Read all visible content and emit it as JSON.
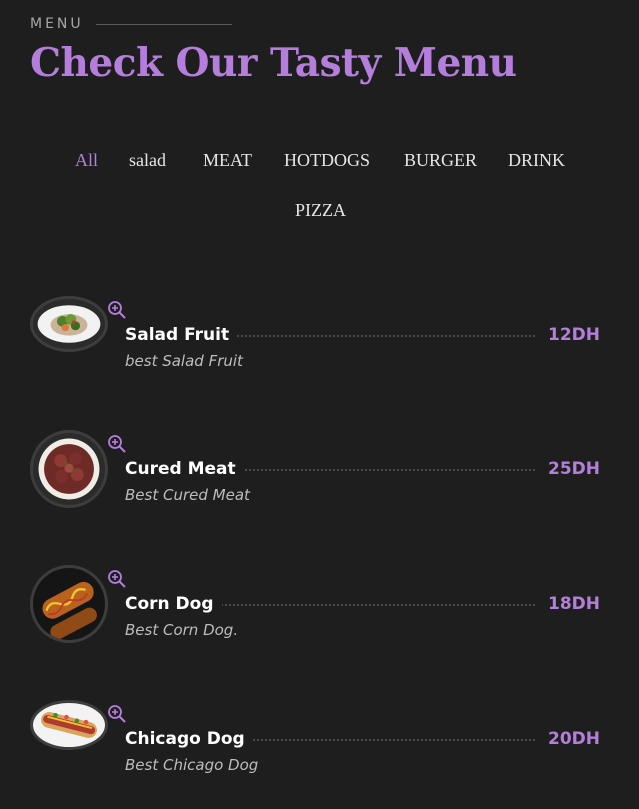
{
  "header": {
    "eyebrow": "MENU",
    "title": "Check Our Tasty Menu"
  },
  "filters": [
    {
      "label": "All",
      "active": true
    },
    {
      "label": "salad",
      "active": false
    },
    {
      "label": "MEAT",
      "active": false
    },
    {
      "label": "HOTDOGS",
      "active": false
    },
    {
      "label": "BURGER",
      "active": false
    },
    {
      "label": "DRINK",
      "active": false
    },
    {
      "label": "PIZZA",
      "active": false
    }
  ],
  "items": [
    {
      "name": "Salad Fruit",
      "price": "12DH",
      "description": "best Salad Fruit",
      "image_icon": "salad-plate-icon"
    },
    {
      "name": "Cured Meat",
      "price": "25DH",
      "description": "Best Cured Meat",
      "image_icon": "cured-meat-icon"
    },
    {
      "name": "Corn Dog",
      "price": "18DH",
      "description": "Best Corn Dog.",
      "image_icon": "corn-dog-icon"
    },
    {
      "name": "Chicago Dog",
      "price": "20DH",
      "description": "Best Chicago Dog",
      "image_icon": "chicago-dog-icon"
    }
  ],
  "colors": {
    "background": "#1e1e1f",
    "accent": "#b57edc",
    "text": "#ffffff",
    "muted": "#bdbdbd"
  }
}
